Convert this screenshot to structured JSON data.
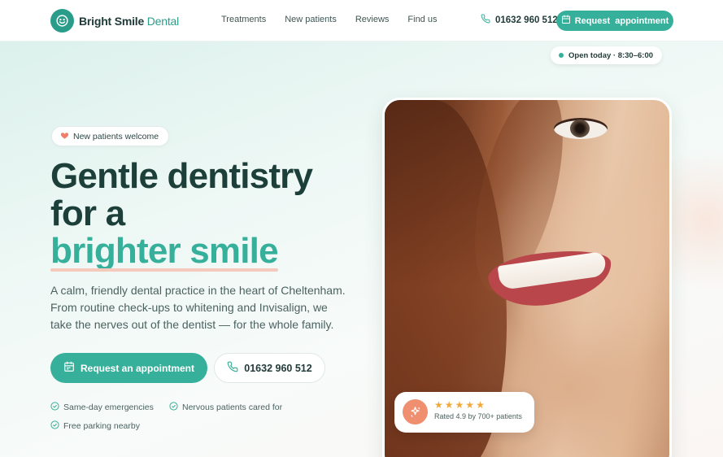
{
  "header": {
    "logo_word1": "Bright Smile",
    "logo_word2": "Dental",
    "nav": [
      {
        "label": "Treatments"
      },
      {
        "label": "New patients"
      },
      {
        "label": "Reviews"
      },
      {
        "label": "Find us"
      }
    ],
    "phone": "01632 960 512",
    "cta_label": "Request  appointment"
  },
  "hero": {
    "badge": "New patients welcome",
    "headline_line1": "Gentle dentistry",
    "headline_line2": "for a",
    "headline_accent": "brighter smile",
    "lede": "A calm, friendly dental practice in the heart of Cheltenham. From routine check-ups to whitening and Invisalign, we take the nerves out of the dentist — for the whole family.",
    "primary_button": "Request an appointment",
    "secondary_button": "01632 960 512",
    "perks": [
      {
        "label": "Same-day emergencies"
      },
      {
        "label": "Nervous patients cared for"
      },
      {
        "label": "Free parking nearby"
      }
    ]
  },
  "photo_card": {
    "open_status": "Open today · 8:30–6:00",
    "rating_stars": 5,
    "rating_text": "Rated 4.9 by 700+ patients"
  },
  "colors": {
    "accent": "#36b09a",
    "heading": "#1d3f3a",
    "underline": "#f5c9bb",
    "rating_icon": "#f08f6f",
    "star": "#f0a93a"
  }
}
